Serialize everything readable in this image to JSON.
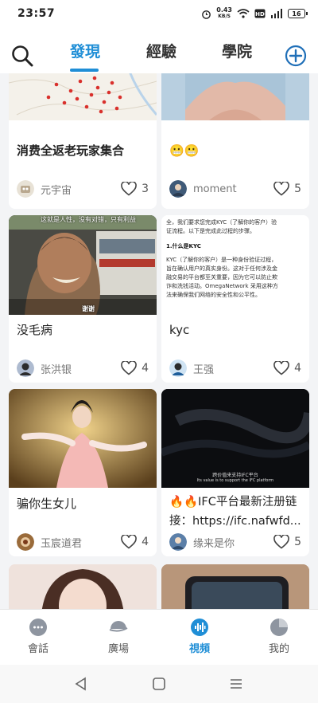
{
  "status_bar": {
    "time": "23:57",
    "net_speed_value": "0.43",
    "net_speed_unit": "KB/S",
    "battery": "16"
  },
  "top_nav": {
    "tabs": [
      {
        "label": "發現",
        "active": true
      },
      {
        "label": "經驗",
        "active": false
      },
      {
        "label": "學院",
        "active": false
      }
    ]
  },
  "feed": {
    "cards": [
      {
        "title": "消费全返老玩家集合",
        "author": "元宇宙",
        "likes": "3",
        "thumb": "map"
      },
      {
        "title": "😬😬",
        "author": "moment",
        "likes": "5",
        "thumb": "portrait"
      },
      {
        "title": "没毛病",
        "author": "张洪银",
        "likes": "4",
        "thumb": "street",
        "overlay_top": "这就是人性，没有对错，只有利益",
        "overlay_bottom": "谢谢"
      },
      {
        "title": "kyc",
        "author": "王强",
        "likes": "4",
        "thumb": "doc",
        "doc_lines": [
          "全，我们要求您完成KYC（了解你的客户）验",
          "证流程。以下是完成此过程的步骤。",
          "1.什么是KYC",
          "KYC（了解你的客户）是一种身份验证过程，",
          "旨在确认用户的真实身份。这对于任何涉及金",
          "融交易的平台都至关重要，因为它可以防止欺",
          "诈和洗钱活动。OmegaNetwork 采用这种方",
          "法来确保我们网络的安全性和公平性。"
        ]
      },
      {
        "title": "骗你生女儿",
        "author": "玉宸道君",
        "likes": "4",
        "thumb": "dancer"
      },
      {
        "title": "🔥🔥IFC平台最新注册链接：https://ifc.nafwfd...",
        "author": "缘来是你",
        "likes": "5",
        "thumb": "dark",
        "subtitle_cn": "跨价值来支持IFC平台",
        "subtitle_en": "Its value is to support the IFC platform"
      },
      {
        "title": "",
        "author": "",
        "likes": "",
        "thumb": "girl"
      },
      {
        "title": "",
        "author": "",
        "likes": "",
        "thumb": "phone"
      }
    ]
  },
  "bottom_nav": {
    "items": [
      {
        "label": "會話",
        "active": false
      },
      {
        "label": "廣場",
        "active": false
      },
      {
        "label": "視頻",
        "active": true
      },
      {
        "label": "我的",
        "active": false
      }
    ]
  },
  "colors": {
    "accent": "#1f8ed6",
    "text": "#222222",
    "muted": "#777777"
  }
}
